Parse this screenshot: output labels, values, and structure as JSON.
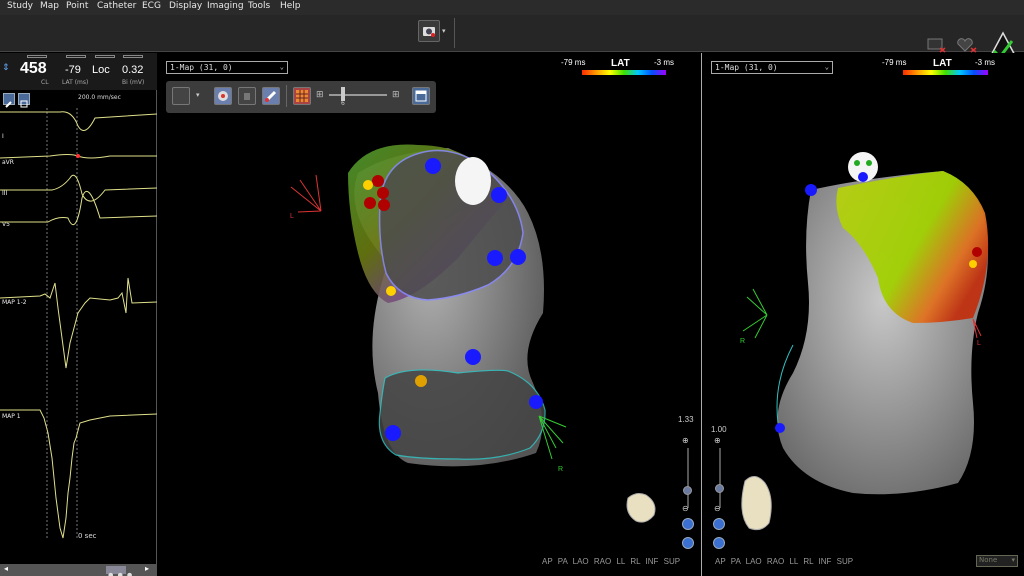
{
  "menu": [
    "Study",
    "Map",
    "Point",
    "Catheter",
    "ECG",
    "Display",
    "Imaging",
    "Tools",
    "Help"
  ],
  "ecg": {
    "cl_value": "458",
    "cl_label": "CL",
    "lat_value": "-79",
    "lat_label": "LAT (ms)",
    "loc_value": "Loc",
    "bi_value": "0.32",
    "bi_label": "Bi (mV)",
    "speed": "200.0 mm/sec",
    "leads": [
      "I",
      "aVR",
      "III",
      "V5",
      "MAP 1-2",
      "MAP 1"
    ],
    "time": "0 sec",
    "scroll_label": "•••"
  },
  "pane1": {
    "map_select": "1-Map (31, 0)",
    "lat_title": "LAT",
    "lat_min": "-79 ms",
    "lat_max": "-3 ms",
    "slider_value": "6",
    "zoom": "1.33",
    "axis_R": "R",
    "axis_L": "L"
  },
  "pane2": {
    "map_select": "1-Map (31, 0)",
    "lat_title": "LAT",
    "lat_min": "-79 ms",
    "lat_max": "-3 ms",
    "zoom": "1.00",
    "axis_R": "R",
    "axis_L": "L"
  },
  "views": [
    "AP",
    "PA",
    "LAO",
    "RAO",
    "LL",
    "RL",
    "INF",
    "SUP"
  ],
  "none_select": "None",
  "colors": {
    "lat_scale": [
      "#ff2a00",
      "#ffff00",
      "#3fe000",
      "#00c8ff",
      "#a000ff"
    ],
    "point_blue": "#1a1aff",
    "point_red": "#b00000",
    "point_yellow": "#ffd000"
  }
}
